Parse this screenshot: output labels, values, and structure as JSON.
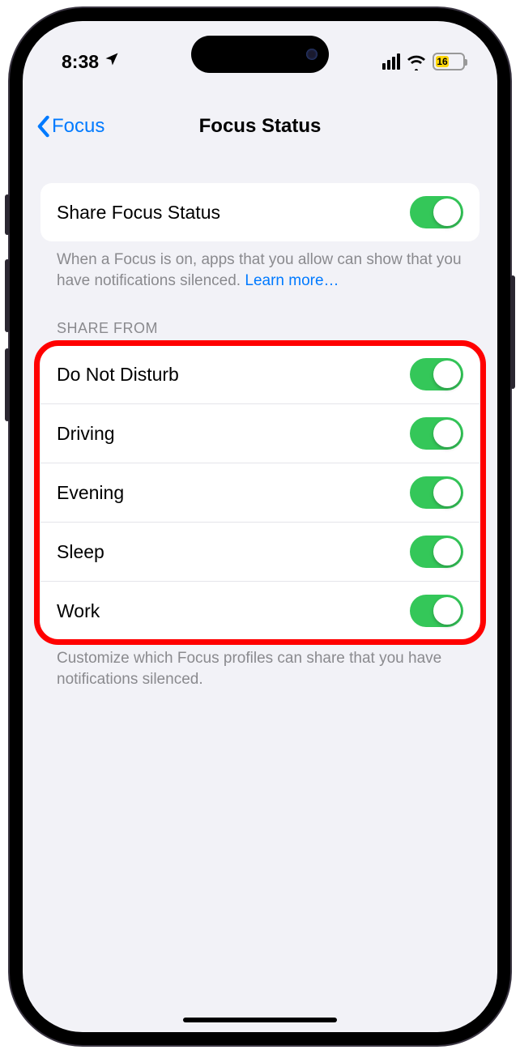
{
  "status": {
    "time": "8:38",
    "battery_pct": "16"
  },
  "nav": {
    "back_label": "Focus",
    "title": "Focus Status"
  },
  "share_section": {
    "label": "Share Focus Status",
    "footer_text": "When a Focus is on, apps that you allow can show that you have notifications silenced. ",
    "learn_more": "Learn more…"
  },
  "share_from": {
    "header": "SHARE FROM",
    "items": [
      {
        "label": "Do Not Disturb"
      },
      {
        "label": "Driving"
      },
      {
        "label": "Evening"
      },
      {
        "label": "Sleep"
      },
      {
        "label": "Work"
      }
    ],
    "footer": "Customize which Focus profiles can share that you have notifications silenced."
  }
}
